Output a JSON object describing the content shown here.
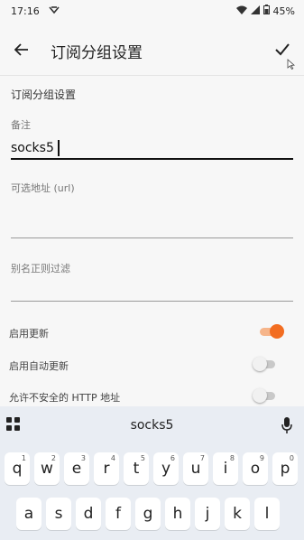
{
  "status_bar": {
    "time": "17:16",
    "battery": "45%"
  },
  "app_bar": {
    "title": "订阅分组设置"
  },
  "form": {
    "section_title": "订阅分组设置",
    "remarks": {
      "label": "备注",
      "value": "socks5"
    },
    "url": {
      "label": "可选地址 (url)",
      "value": ""
    },
    "alias_filter": {
      "label": "别名正则过滤",
      "value": ""
    }
  },
  "settings": [
    {
      "label": "启用更新",
      "enabled": true
    },
    {
      "label": "启用自动更新",
      "enabled": false
    },
    {
      "label": "允许不安全的 HTTP 地址",
      "enabled": false
    }
  ],
  "colors": {
    "accent": "#f26d21",
    "accent_track": "#f6b58a"
  },
  "keyboard": {
    "suggestion": "socks5",
    "row1": [
      {
        "key": "q",
        "hint": "1"
      },
      {
        "key": "w",
        "hint": "2"
      },
      {
        "key": "e",
        "hint": "3"
      },
      {
        "key": "r",
        "hint": "4"
      },
      {
        "key": "t",
        "hint": "5"
      },
      {
        "key": "y",
        "hint": "6"
      },
      {
        "key": "u",
        "hint": "7"
      },
      {
        "key": "i",
        "hint": "8"
      },
      {
        "key": "o",
        "hint": "9"
      },
      {
        "key": "p",
        "hint": "0"
      }
    ],
    "row2": [
      "a",
      "s",
      "d",
      "f",
      "g",
      "h",
      "j",
      "k",
      "l"
    ]
  }
}
